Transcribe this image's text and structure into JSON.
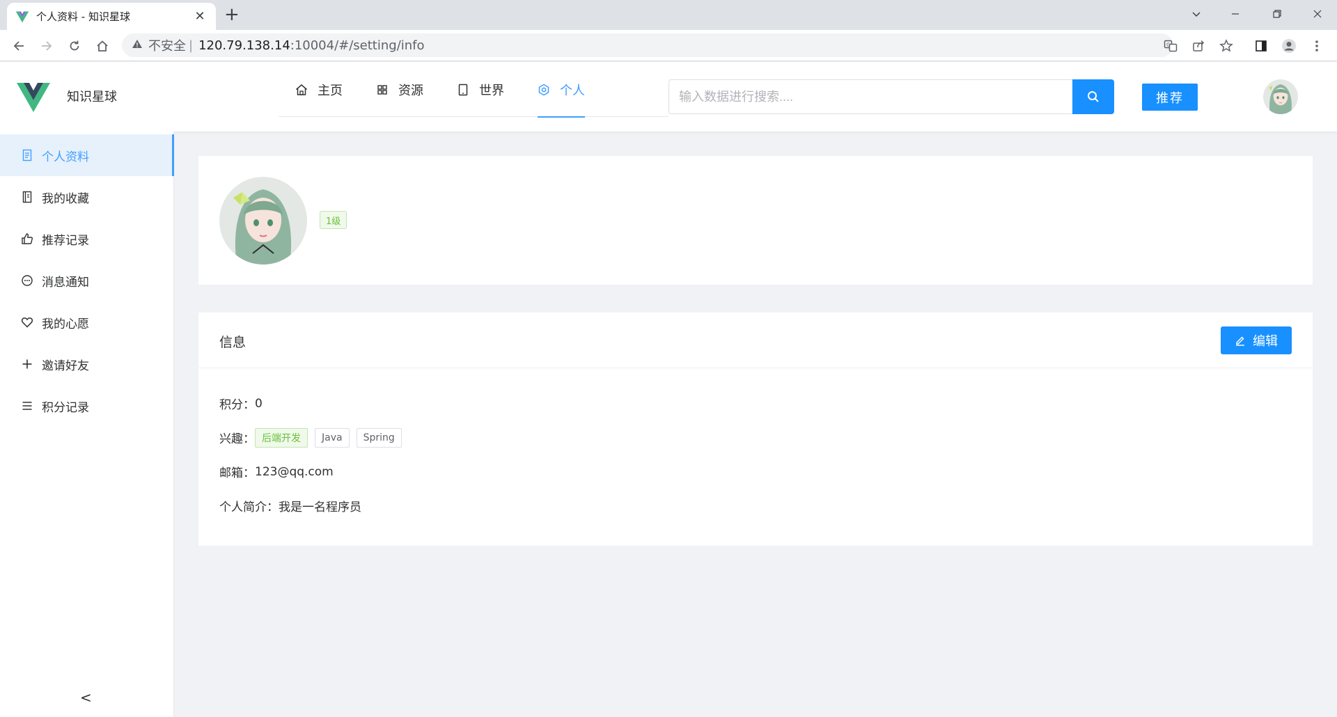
{
  "browser": {
    "tab_title": "个人资料 - 知识星球",
    "tab_close": "✕",
    "new_tab": "+",
    "address": {
      "insecure_label": "不安全",
      "separator": "|",
      "host": "120.79.138.14",
      "path": ":10004/#/setting/info"
    }
  },
  "header": {
    "brand": "知识星球",
    "menu": [
      {
        "label": "主页",
        "icon": "home-icon"
      },
      {
        "label": "资源",
        "icon": "grid-icon"
      },
      {
        "label": "世界",
        "icon": "phone-icon"
      },
      {
        "label": "个人",
        "icon": "gear-icon",
        "active": true
      }
    ],
    "search_placeholder": "输入数据进行搜索....",
    "recommend_label": "推荐"
  },
  "sidebar": {
    "items": [
      {
        "label": "个人资料",
        "icon": "document-icon",
        "active": true
      },
      {
        "label": "我的收藏",
        "icon": "notebook-icon"
      },
      {
        "label": "推荐记录",
        "icon": "thumb-up-icon"
      },
      {
        "label": "消息通知",
        "icon": "chat-dot-icon"
      },
      {
        "label": "我的心愿",
        "icon": "heart-icon"
      },
      {
        "label": "邀请好友",
        "icon": "plus-icon"
      },
      {
        "label": "积分记录",
        "icon": "menu-icon"
      }
    ],
    "collapse_label": "<"
  },
  "profile": {
    "level": "1级"
  },
  "info": {
    "title": "信息",
    "edit_label": "编辑",
    "points_label": "积分：",
    "points_value": "0",
    "interests_label": "兴趣：",
    "interests": [
      "后端开发",
      "Java",
      "Spring"
    ],
    "email_label": "邮箱：",
    "email": "123@qq.com",
    "bio_label": "个人简介：",
    "bio": "我是一名程序员"
  },
  "colors": {
    "primary": "#1890ff",
    "accent": "#409eff",
    "success": "#67c23a",
    "page_bg": "#f0f2f5"
  }
}
